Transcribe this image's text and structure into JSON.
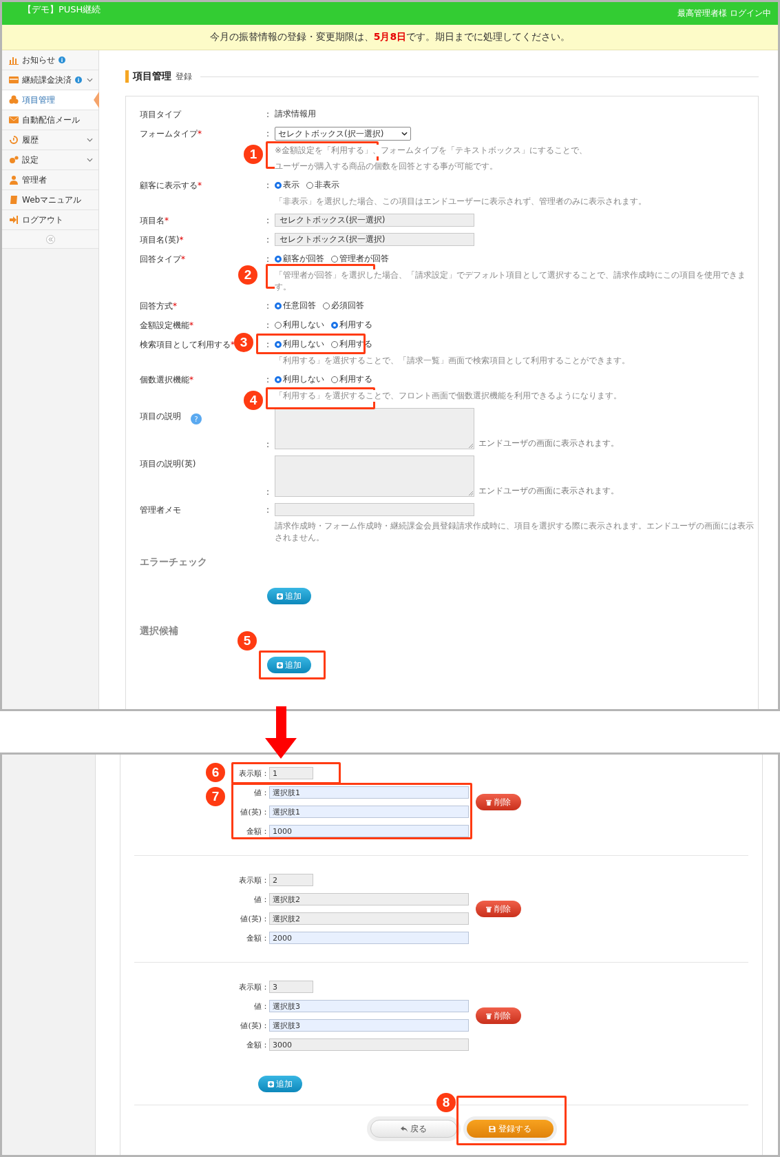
{
  "header": {
    "title": "【デモ】PUSH継続",
    "user": "最高管理者様 ログイン中"
  },
  "notice": {
    "text": "今月の振替情報の登録・変更期限は、**5月8日**です。期日までに処理してください。"
  },
  "sidebar": {
    "items": [
      {
        "label": "お知らせ",
        "info": true,
        "expandable": false,
        "selected": false
      },
      {
        "label": "継続課金決済",
        "info": true,
        "expandable": true,
        "selected": false
      },
      {
        "label": "項目管理",
        "info": false,
        "expandable": false,
        "selected": true
      },
      {
        "label": "自動配信メール",
        "info": false,
        "expandable": false,
        "selected": false
      },
      {
        "label": "履歴",
        "info": false,
        "expandable": true,
        "selected": false
      },
      {
        "label": "設定",
        "info": false,
        "expandable": true,
        "selected": false
      },
      {
        "label": "管理者",
        "info": false,
        "expandable": false,
        "selected": false
      },
      {
        "label": "Webマニュアル",
        "info": false,
        "expandable": false,
        "selected": false
      },
      {
        "label": "ログアウト",
        "info": false,
        "expandable": false,
        "selected": false
      }
    ]
  },
  "page": {
    "title": "項目管理",
    "subtitle": "登録"
  },
  "fields": [
    {
      "kind": "text",
      "label": "項目タイプ",
      "colon": ":",
      "value": "請求情報用"
    },
    {
      "kind": "select",
      "label": "フォームタイプ",
      "required_mark": "*",
      "colon": ":",
      "value": "セレクトボックス(択一選択)",
      "hint": [
        "※金額設定を「利用する」、フォームタイプを「テキストボックス」にすることで、",
        "ユーザーが購入する商品の個数を回答とする事が可能です。"
      ]
    },
    {
      "kind": "radio",
      "label": "顧客に表示する",
      "required_mark": "*",
      "colon": ":",
      "options": [
        {
          "label": "表示",
          "selected": true
        },
        {
          "label": "非表示",
          "selected": false
        }
      ],
      "hint": [
        "「非表示」を選択した場合、この項目はエンドユーザーに表示されず、管理者のみに表示されます。"
      ]
    },
    {
      "kind": "input",
      "label": "項目名",
      "required_mark": "*",
      "colon": ":",
      "value": "セレクトボックス(択一選択)"
    },
    {
      "kind": "input",
      "label": "項目名(英)",
      "required_mark": "*",
      "colon": ":",
      "value": "セレクトボックス(択一選択)"
    },
    {
      "kind": "radio",
      "label": "回答タイプ",
      "required_mark": "*",
      "colon": ":",
      "options": [
        {
          "label": "顧客が回答",
          "selected": true
        },
        {
          "label": "管理者が回答",
          "selected": false
        }
      ],
      "hint": [
        "「管理者が回答」を選択した場合、「請求設定」でデフォルト項目として選択することで、請求作成時にこの項目を使用できます。"
      ]
    },
    {
      "kind": "radio",
      "label": "回答方式",
      "required_mark": "*",
      "colon": ":",
      "options": [
        {
          "label": "任意回答",
          "selected": true
        },
        {
          "label": "必須回答",
          "selected": false
        }
      ]
    },
    {
      "kind": "radio",
      "label": "金額設定機能",
      "required_mark": "*",
      "colon": ":",
      "options": [
        {
          "label": "利用しない",
          "selected": false
        },
        {
          "label": "利用する",
          "selected": true
        }
      ]
    },
    {
      "kind": "radio",
      "label": "検索項目として利用する",
      "required_mark": "*",
      "colon": ":",
      "options": [
        {
          "label": "利用しない",
          "selected": true
        },
        {
          "label": "利用する",
          "selected": false
        }
      ],
      "hint": [
        "「利用する」を選択することで、「請求一覧」画面で検索項目として利用することができます。"
      ]
    },
    {
      "kind": "radio",
      "label": "個数選択機能",
      "required_mark": "*",
      "colon": ":",
      "options": [
        {
          "label": "利用しない",
          "selected": true
        },
        {
          "label": "利用する",
          "selected": false
        }
      ],
      "hint": [
        "「利用する」を選択することで、フロント画面で個数選択機能を利用できるようになります。"
      ]
    },
    {
      "kind": "textarea",
      "label": "項目の説明",
      "help": "?",
      "colon": ":",
      "note": "エンドユーザの画面に表示されます。"
    },
    {
      "kind": "textarea",
      "label": "項目の説明(英)",
      "colon": ":",
      "note": "エンドユーザの画面に表示されます。"
    },
    {
      "kind": "input",
      "label": "管理者メモ",
      "colon": ":",
      "hint": [
        "請求作成時・フォーム作成時・継続課金会員登録請求作成時に、項目を選択する際に表示されます。エンドユーザの画面には表示されません。"
      ]
    }
  ],
  "error_check": {
    "title": "エラーチェック",
    "add_button": "追加"
  },
  "choices_section": {
    "title": "選択候補",
    "add_button": "追加"
  },
  "choices": [
    {
      "fields": [
        {
          "label": "表示順：",
          "value": "1",
          "highlighted": false
        },
        {
          "label": "値：",
          "value": "選択肢1",
          "highlighted": true
        },
        {
          "label": "値(英)：",
          "value": "選択肢1",
          "highlighted": true
        },
        {
          "label": "金額：",
          "value": "1000",
          "highlighted": true
        }
      ],
      "delete_button": "削除"
    },
    {
      "fields": [
        {
          "label": "表示順：",
          "value": "2",
          "highlighted": false
        },
        {
          "label": "値：",
          "value": "選択肢2",
          "highlighted": false
        },
        {
          "label": "値(英)：",
          "value": "選択肢2",
          "highlighted": false
        },
        {
          "label": "金額：",
          "value": "2000",
          "highlighted": true
        }
      ],
      "delete_button": "削除"
    },
    {
      "fields": [
        {
          "label": "表示順：",
          "value": "3",
          "highlighted": false
        },
        {
          "label": "値：",
          "value": "選択肢3",
          "highlighted": true
        },
        {
          "label": "値(英)：",
          "value": "選択肢3",
          "highlighted": true
        },
        {
          "label": "金額：",
          "value": "3000",
          "highlighted": false
        }
      ],
      "delete_button": "削除"
    }
  ],
  "choices_add_button": "追加",
  "footer": {
    "back_button": "戻る",
    "submit_button": "登録する"
  },
  "callouts": [
    {
      "number": "1"
    },
    {
      "number": "2"
    },
    {
      "number": "3"
    },
    {
      "number": "4"
    },
    {
      "number": "5"
    },
    {
      "number": "6"
    },
    {
      "number": "7"
    },
    {
      "number": "8"
    }
  ]
}
